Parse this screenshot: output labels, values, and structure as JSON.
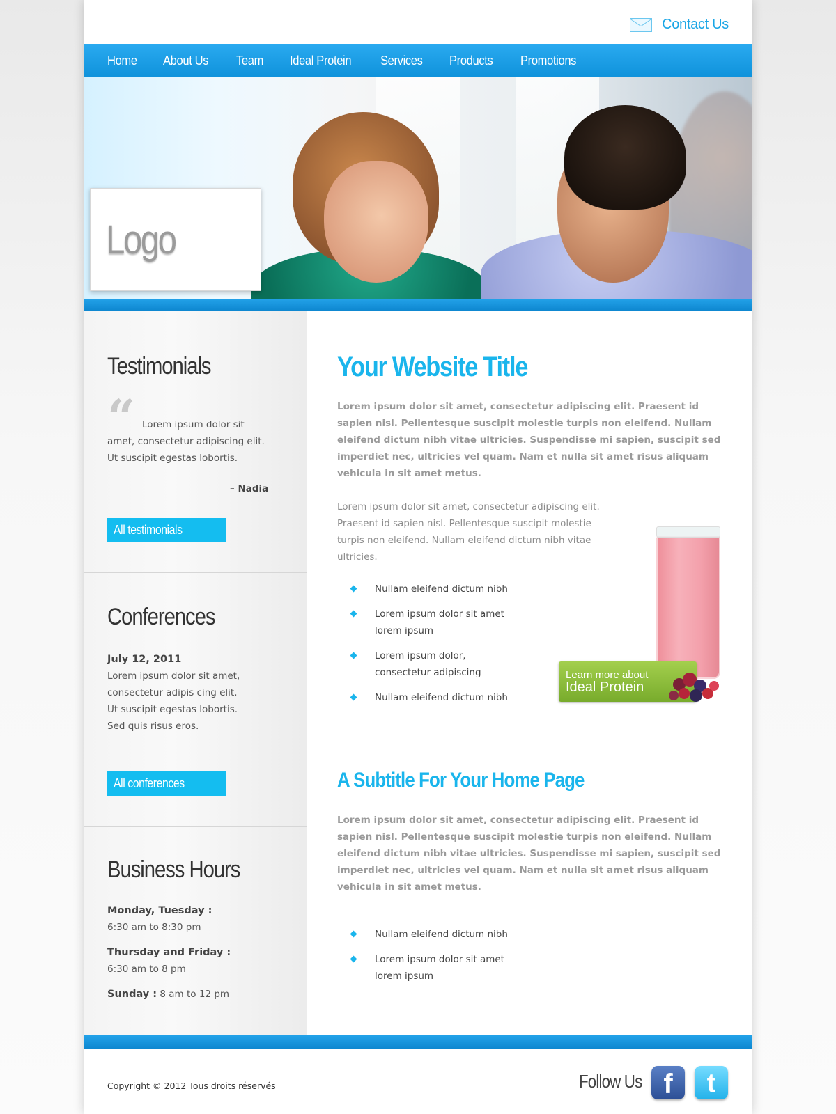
{
  "header": {
    "contact_label": "Contact Us"
  },
  "nav": {
    "items": [
      "Home",
      "About Us",
      "Team",
      "Ideal Protein",
      "Services",
      "Products",
      "Promotions"
    ]
  },
  "hero": {
    "logo_text": "Logo"
  },
  "sidebar": {
    "testimonials": {
      "title": "Testimonials",
      "quote": "Lorem ipsum dolor sit amet, consectetur adipiscing elit. Ut suscipit egestas lobortis.",
      "author": "– Nadia",
      "button": "All testimonials"
    },
    "conferences": {
      "title": "Conferences",
      "date": "July 12, 2011",
      "text": "Lorem ipsum dolor sit amet, consectetur adipis cing elit. Ut suscipit egestas lobortis. Sed quis risus eros.",
      "button": "All conferences"
    },
    "hours": {
      "title": "Business Hours",
      "rows": [
        {
          "day": "Monday, Tuesday :",
          "time": "6:30 am to 8:30 pm"
        },
        {
          "day": "Thursday and Friday :",
          "time": "6:30 am to 8 pm"
        },
        {
          "day": "Sunday :",
          "time": "8 am to 12 pm"
        }
      ]
    }
  },
  "main": {
    "title": "Your Website Title",
    "intro_bold": "Lorem ipsum dolor sit amet, consectetur adipiscing elit. Praesent id sapien nisl. Pellentesque suscipit molestie turpis non eleifend. Nullam eleifend dictum nibh vitae ultricies. Suspendisse mi sapien, suscipit sed imperdiet nec, ultricies vel quam. Nam et nulla sit amet risus aliquam vehicula in sit amet metus.",
    "intro_regular": "Lorem ipsum dolor sit amet, consectetur adipiscing elit. Praesent id sapien nisl. Pellentesque suscipit molestie turpis non eleifend. Nullam eleifend dictum nibh vitae ultricies.",
    "bullets_1": [
      "Nullam eleifend dictum nibh",
      "Lorem ipsum dolor sit amet lorem ipsum",
      "Lorem ipsum dolor, consectetur adipiscing",
      "Nullam eleifend dictum nibh"
    ],
    "promo": {
      "line1": "Learn more about",
      "line2": "Ideal Protein"
    },
    "subtitle": "A Subtitle For Your Home Page",
    "body_bold": "Lorem ipsum dolor sit amet, consectetur adipiscing elit. Praesent id sapien nisl. Pellentesque suscipit molestie turpis non eleifend. Nullam eleifend dictum nibh vitae ultricies. Suspendisse mi sapien, suscipit sed imperdiet nec, ultricies vel quam. Nam et nulla sit amet risus aliquam vehicula in sit amet metus.",
    "bullets_2": [
      "Nullam eleifend dictum nibh",
      "Lorem ipsum dolor sit amet lorem ipsum"
    ]
  },
  "footer": {
    "copyright": "Copyright © 2012 Tous droits réservés",
    "follow_label": "Follow Us",
    "facebook_glyph": "f",
    "twitter_glyph": "t"
  },
  "colors": {
    "accent": "#1ab5ec",
    "nav_blue": "#1a9de5",
    "button_blue": "#14bdf0",
    "promo_green": "#8cbf3a"
  }
}
